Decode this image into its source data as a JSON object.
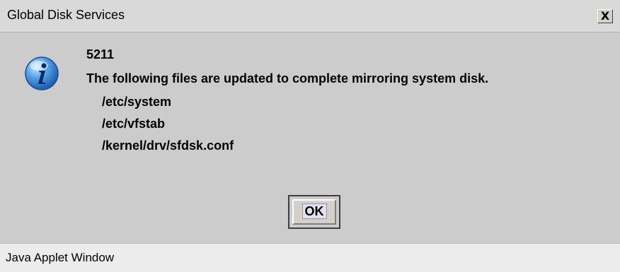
{
  "window": {
    "title": "Global Disk Services",
    "close_glyph": "X"
  },
  "message": {
    "icon": "info-icon",
    "code": "5211",
    "text": "The following files are updated to complete mirroring system disk.",
    "files": [
      "/etc/system",
      "/etc/vfstab",
      "/kernel/drv/sfdsk.conf"
    ]
  },
  "buttons": {
    "ok_label": "OK"
  },
  "statusbar": {
    "text": "Java Applet Window"
  },
  "colors": {
    "icon_blue": "#3a8fd8",
    "dialog_bg": "#cccccc"
  }
}
